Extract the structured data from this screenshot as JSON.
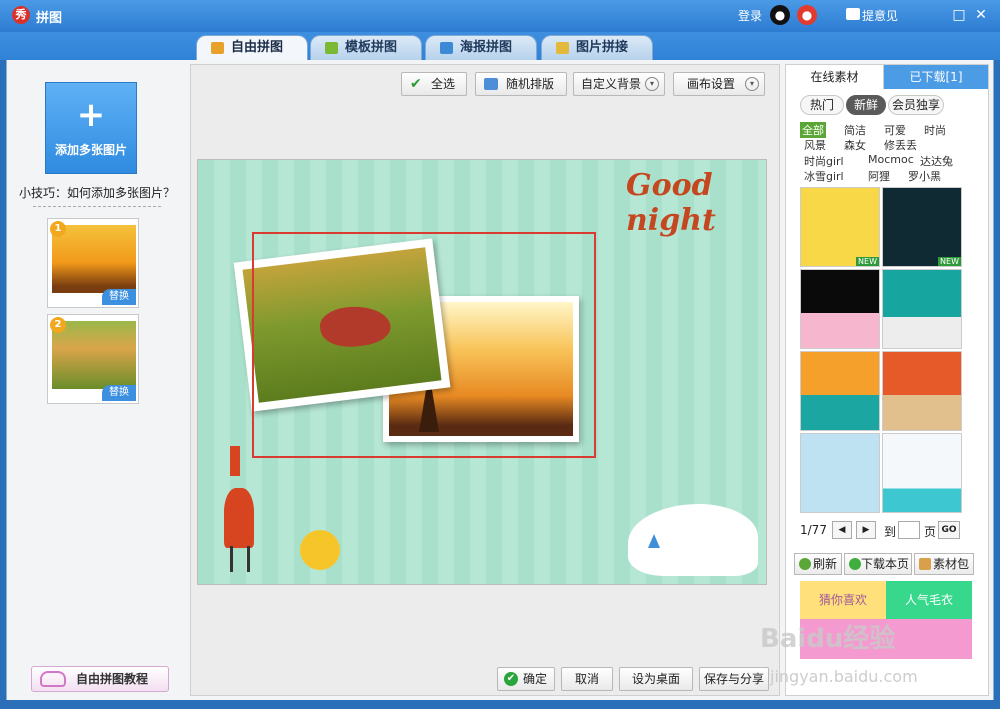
{
  "window": {
    "title": "拼图",
    "logo_text": "秀",
    "login": "登录",
    "feedback": "提意见",
    "maximize": "□",
    "close": "✕"
  },
  "tabs": [
    {
      "label": "自由拼图",
      "active": true,
      "icon_color": "#e8a12a"
    },
    {
      "label": "模板拼图",
      "active": false,
      "icon_color": "#7bb935"
    },
    {
      "label": "海报拼图",
      "active": false,
      "icon_color": "#3c8ad6"
    },
    {
      "label": "图片拼接",
      "active": false,
      "icon_color": "#e2b93a"
    }
  ],
  "left": {
    "add_button_plus": "+",
    "add_button": "添加多张图片",
    "tip": "小技巧：如何添加多张图片？",
    "thumbnails": [
      {
        "number": "1",
        "replace": "替换"
      },
      {
        "number": "2",
        "replace": "替换"
      }
    ],
    "tutorial": "自由拼图教程"
  },
  "toolbar": {
    "select_all": "全选",
    "random_layout": "随机排版",
    "custom_background": "自定义背景",
    "canvas_settings": "画布设置",
    "chevron": "▾"
  },
  "canvas": {
    "goodnight": "Good night"
  },
  "footer": {
    "confirm": "确定",
    "cancel": "取消",
    "set_as_desktop": "设为桌面",
    "save_share": "保存与分享"
  },
  "right": {
    "tab_online": "在线素材",
    "tab_downloaded": "已下载[1]",
    "chips": [
      "热门",
      "新鲜",
      "会员独享"
    ],
    "categories": [
      [
        "全部",
        "简洁",
        "可爱",
        "时尚"
      ],
      [
        "风景",
        "森女",
        "修丢丢"
      ],
      [
        "时尚girl",
        "Mocmoc",
        "达达兔"
      ],
      [
        "冰雪girl",
        "阿狸",
        "罗小黑"
      ]
    ],
    "sticker_new": "NEW",
    "pager": "1/77",
    "prev": "◀",
    "next": "▶",
    "goto": "到",
    "page_unit": "页",
    "go": "GO",
    "refresh": "刷新",
    "download_page": "下载本页",
    "material_pack": "素材包",
    "banner_guess": "猜你喜欢",
    "banner_popular": "人气毛衣"
  },
  "watermark": {
    "main": "Baidu经验",
    "sub": "jingyan.baidu.com"
  }
}
